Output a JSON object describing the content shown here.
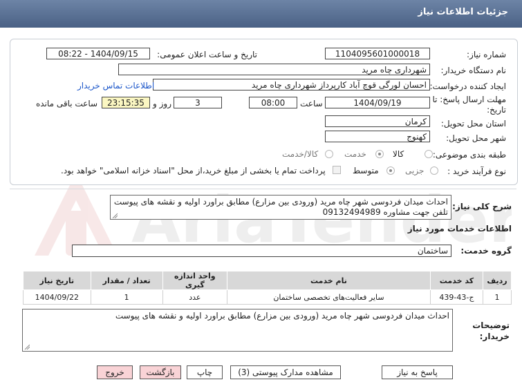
{
  "header": {
    "title": "جزئیات اطلاعات نیاز"
  },
  "form": {
    "need_number_label": "شماره نیاز:",
    "need_number": "1104095601000018",
    "announce_label": "تاریخ و ساعت اعلان عمومی:",
    "announce_value": "1404/09/15 - 08:22",
    "buyer_label": "نام دستگاه خریدار:",
    "buyer_value": "شهرداری چاه مرید",
    "creator_label": "ایجاد کننده درخواست:",
    "creator_value": "احسان لورگی قوچ آباد کارپرداز شهرداری چاه مرید",
    "contact_link": "اطلاعات تماس خریدار",
    "deadline_label": "مهلت ارسال پاسخ: تا تاریخ:",
    "deadline_date": "1404/09/19",
    "time_label": "ساعت",
    "deadline_time": "08:00",
    "days_value": "3",
    "days_label": "روز و",
    "remaining_time": "23:15:35",
    "remaining_label": "ساعت باقی مانده",
    "province_label": "استان محل تحویل:",
    "province_value": "کرمان",
    "city_label": "شهر محل تحویل:",
    "city_value": "کهنوج",
    "category_label": "طبقه بندی موضوعی:",
    "category_options": [
      "کالا",
      "خدمت",
      "کالا/خدمت"
    ],
    "process_label": "نوع فرآیند خرید :",
    "process_options": [
      "جزیی",
      "متوسط"
    ],
    "payment_note": "پرداخت تمام یا بخشی از مبلغ خرید،از محل \"اسناد خزانه اسلامی\" خواهد بود."
  },
  "description": {
    "label": "شرح کلی نیاز:",
    "text": "احداث میدان فردوسی شهر چاه مرید (ورودی بین مزارع) مطابق براورد اولیه و نقشه های پیوست تلفن جهت مشاوره 09132494989"
  },
  "services": {
    "section_title": "اطلاعات خدمات مورد نیاز",
    "group_label": "گروه خدمت:",
    "group_value": "ساختمان",
    "table_headers": [
      "ردیف",
      "کد خدمت",
      "نام خدمت",
      "واحد اندازه گیری",
      "تعداد / مقدار",
      "تاریخ نیاز"
    ],
    "rows": [
      [
        "1",
        "ج-43-439",
        "سایر فعالیت‌های تخصصی ساختمان",
        "عدد",
        "1",
        "1404/09/22"
      ]
    ]
  },
  "buyer_notes": {
    "label": "توضیحات خریدار:",
    "text": "احداث میدان فردوسی شهر چاه مرید (ورودی بین مزارع) مطابق براورد اولیه و نقشه های پیوست"
  },
  "buttons": {
    "reply": "پاسخ به نیاز",
    "attachments": "مشاهده مدارک پیوستی (3)",
    "print": "چاپ",
    "back": "بازگشت",
    "exit": "خروج"
  },
  "watermark": {
    "brand": "AriaTender.net"
  },
  "colors": {
    "header": "#5a7196",
    "link": "#1a55c9",
    "yellow": "#fbf7c2",
    "pink": "#f9d3d6"
  }
}
